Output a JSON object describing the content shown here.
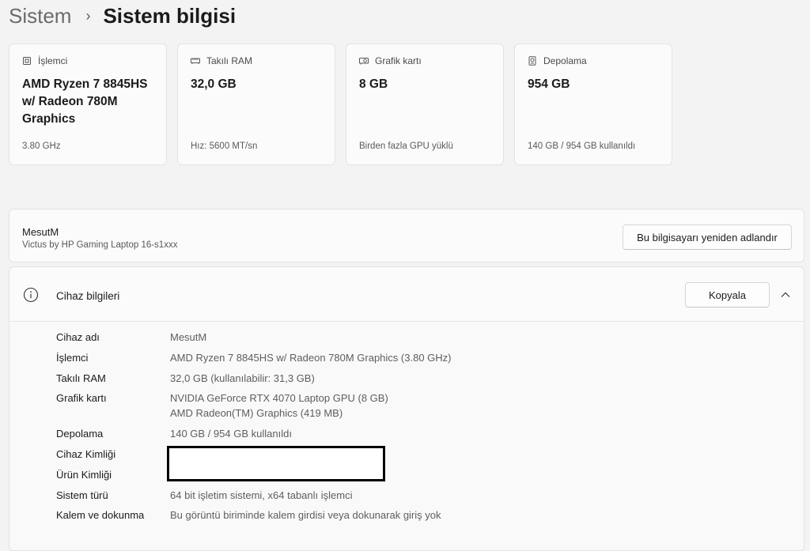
{
  "breadcrumb": {
    "parent": "Sistem",
    "separator": "›",
    "current": "Sistem bilgisi"
  },
  "cards": [
    {
      "label": "İşlemci",
      "icon": "processor-icon",
      "value": "AMD Ryzen 7 8845HS w/ Radeon 780M Graphics",
      "sub": "3.80 GHz"
    },
    {
      "label": "Takılı RAM",
      "icon": "ram-icon",
      "value": "32,0 GB",
      "sub": "Hız: 5600 MT/sn"
    },
    {
      "label": "Grafik kartı",
      "icon": "graphics-card-icon",
      "value": "8 GB",
      "sub": "Birden fazla GPU yüklü"
    },
    {
      "label": "Depolama",
      "icon": "storage-icon",
      "value": "954 GB",
      "sub": "140 GB / 954 GB kullanıldı"
    }
  ],
  "device": {
    "name": "MesutM",
    "model": "Victus by HP Gaming Laptop 16-s1xxx",
    "rename_label": "Bu bilgisayarı yeniden adlandır"
  },
  "device_info": {
    "title": "Cihaz bilgileri",
    "copy_label": "Kopyala",
    "specs": [
      {
        "label": "Cihaz adı",
        "value": "MesutM"
      },
      {
        "label": "İşlemci",
        "value": "AMD Ryzen 7 8845HS w/ Radeon 780M Graphics (3.80 GHz)"
      },
      {
        "label": "Takılı RAM",
        "value": "32,0 GB (kullanılabilir: 31,3 GB)"
      },
      {
        "label": "Grafik kartı",
        "value": "NVIDIA GeForce RTX 4070 Laptop GPU (8 GB)",
        "value2": "AMD Radeon(TM) Graphics (419 MB)"
      },
      {
        "label": "Depolama",
        "value": "140 GB / 954 GB kullanıldı"
      },
      {
        "label": "Cihaz Kimliği",
        "value": ""
      },
      {
        "label": "Ürün Kimliği",
        "value": ""
      },
      {
        "label": "Sistem türü",
        "value": "64 bit işletim sistemi, x64 tabanlı işlemci"
      },
      {
        "label": "Kalem ve dokunma",
        "value": "Bu görüntü biriminde kalem girdisi veya dokunarak giriş yok"
      }
    ]
  }
}
